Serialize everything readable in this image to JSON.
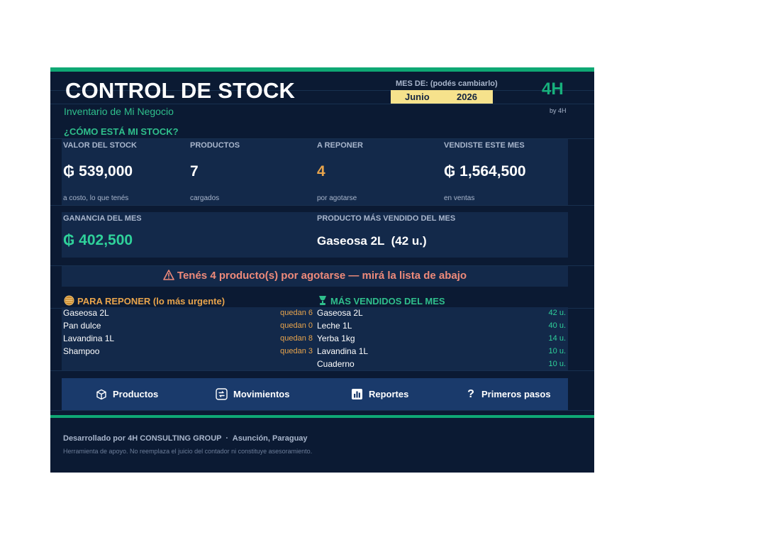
{
  "header": {
    "title": "CONTROL DE STOCK",
    "subtitle": "Inventario de Mi Negocio",
    "month_label": "MES DE:  (podés cambiarlo)",
    "month": "Junio",
    "year": "2026",
    "logo": "4H",
    "byline": "by 4H"
  },
  "stock_section": {
    "title": "¿CÓMO ESTÁ MI STOCK?",
    "kpis": [
      {
        "label": "VALOR DEL STOCK",
        "value": "₲ 539,000",
        "sub": "a costo, lo que tenés"
      },
      {
        "label": "PRODUCTOS",
        "value": "7",
        "sub": "cargados"
      },
      {
        "label": "A REPONER",
        "value": "4",
        "sub": "por agotarse"
      },
      {
        "label": "VENDISTE ESTE MES",
        "value": "₲ 1,564,500",
        "sub": "en ventas"
      }
    ],
    "profit": {
      "label": "GANANCIA DEL MES",
      "value": "₲ 402,500"
    },
    "top_product": {
      "label": "PRODUCTO MÁS VENDIDO DEL MES",
      "value": "Gaseosa 2L  (42 u.)"
    }
  },
  "alert": {
    "icon": "warning-icon",
    "text": "Tenés 4 producto(s) por agotarse — mirá la lista de abajo"
  },
  "restock": {
    "title": "PARA REPONER (lo más urgente)",
    "icon": "orange-circle-icon",
    "items": [
      {
        "name": "Gaseosa 2L",
        "qty": "quedan 6"
      },
      {
        "name": "Pan dulce",
        "qty": "quedan 0"
      },
      {
        "name": "Lavandina 1L",
        "qty": "quedan 8"
      },
      {
        "name": "Shampoo",
        "qty": "quedan 3"
      }
    ]
  },
  "best_sellers": {
    "title": "MÁS VENDIDOS DEL MES",
    "icon": "trophy-icon",
    "items": [
      {
        "name": "Gaseosa 2L",
        "qty": "42 u."
      },
      {
        "name": "Leche 1L",
        "qty": "40 u."
      },
      {
        "name": "Yerba 1kg",
        "qty": "14 u."
      },
      {
        "name": "Lavandina 1L",
        "qty": "10 u."
      },
      {
        "name": "Cuaderno",
        "qty": "10 u."
      }
    ]
  },
  "nav": [
    {
      "label": "Productos",
      "icon": "cube-icon"
    },
    {
      "label": "Movimientos",
      "icon": "arrows-icon"
    },
    {
      "label": "Reportes",
      "icon": "bar-chart-icon"
    },
    {
      "label": "Primeros pasos",
      "icon": "question-icon"
    }
  ],
  "footer": {
    "credit": "Desarrollado por 4H CONSULTING GROUP  ·  Asunción, Paraguay",
    "disclaimer": "Herramienta de apoyo. No reemplaza el juicio del contador ni constituye asesoramiento."
  },
  "colors": {
    "background": "#0b1a33",
    "panel": "#13294a",
    "accent_green": "#0fa874",
    "accent_orange": "#e8a44c",
    "month_box": "#f6e28c",
    "alert_text": "#ee8a7a",
    "nav_bar": "#1a3a6b"
  }
}
